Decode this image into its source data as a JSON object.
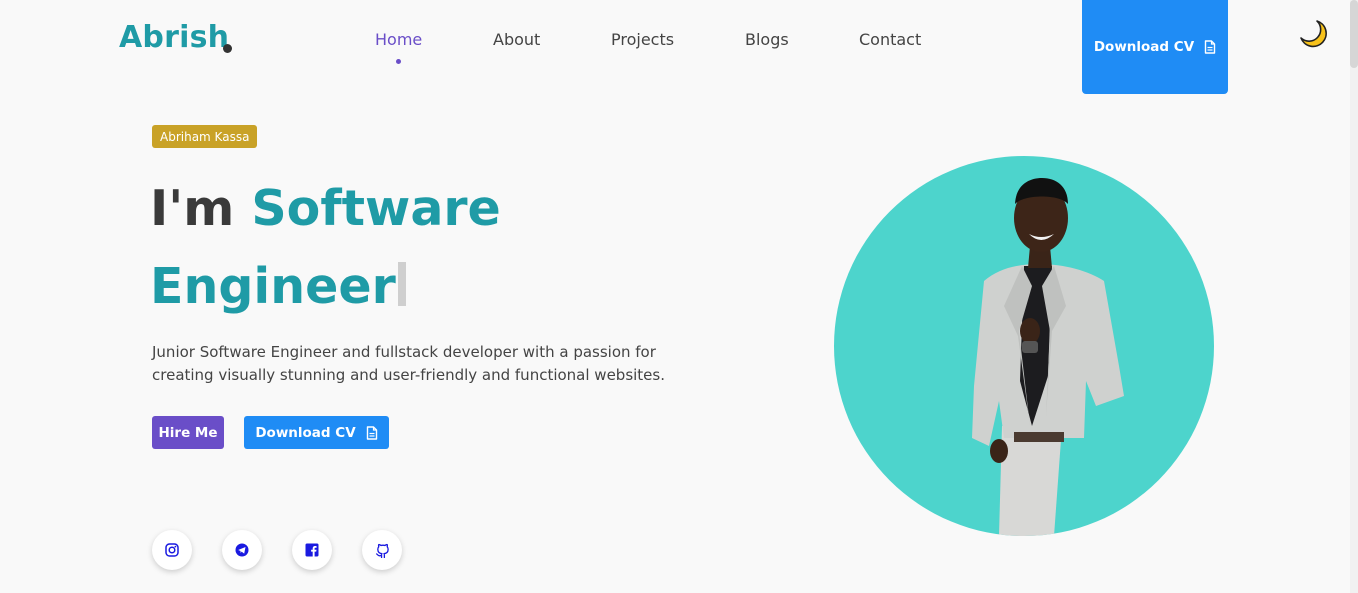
{
  "header": {
    "logo": "Abrish",
    "nav": [
      {
        "label": "Home",
        "active": true
      },
      {
        "label": "About",
        "active": false
      },
      {
        "label": "Projects",
        "active": false
      },
      {
        "label": "Blogs",
        "active": false
      },
      {
        "label": "Contact",
        "active": false
      }
    ],
    "download_cv_label": "Download CV",
    "theme_toggle_icon": "moon-icon"
  },
  "hero": {
    "badge": "Abriham Kassa",
    "headline_prefix": "I'm",
    "headline_highlight_line1": "Software",
    "headline_highlight_line2": "Engineer",
    "description": "Junior Software Engineer and fullstack developer with a passion for creating visually stunning and user-friendly and functional websites.",
    "hire_label": "Hire Me",
    "download_cv_label": "Download CV",
    "socials": [
      "instagram-icon",
      "telegram-icon",
      "facebook-icon",
      "github-icon"
    ]
  },
  "colors": {
    "brand_teal": "#1f9ba6",
    "accent_purple": "#6a4ec8",
    "button_blue": "#1f8cf5",
    "badge_gold": "#c9a227",
    "portrait_bg": "#4dd4cc",
    "social_icon": "#1a1ae0"
  }
}
